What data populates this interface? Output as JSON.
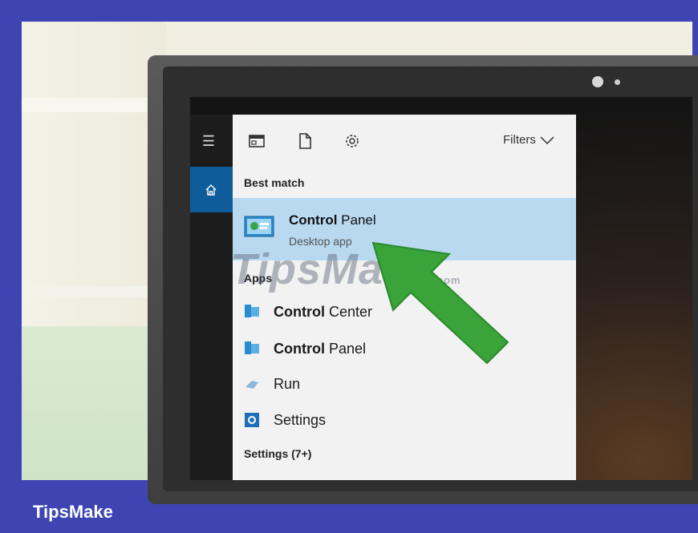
{
  "start_menu": {
    "toolbar": {
      "filters_label": "Filters",
      "icons": [
        "app-window-icon",
        "document-icon",
        "gear-icon"
      ]
    },
    "best_match": {
      "header": "Best match",
      "item": {
        "bold": "Control",
        "rest": " Panel",
        "subtitle": "Desktop app"
      }
    },
    "apps": {
      "header": "Apps",
      "items": [
        {
          "bold": "Control",
          "rest": " Center",
          "icon": "control-panel-icon"
        },
        {
          "bold": "Control",
          "rest": " Panel",
          "icon": "control-panel-icon"
        },
        {
          "bold": "",
          "rest": "Run",
          "icon": "run-icon"
        },
        {
          "bold": "",
          "rest": "Settings",
          "icon": "settings-icon"
        }
      ]
    },
    "settings_header": "Settings (7+)"
  },
  "watermark": {
    "main": "TipsMake",
    "suffix": ".com"
  },
  "caption": "TipsMake",
  "colors": {
    "frame": "#3e45b3",
    "highlight": "#b9d9f1",
    "home_button": "#0f5c9a",
    "arrow": "#3aa33a"
  }
}
